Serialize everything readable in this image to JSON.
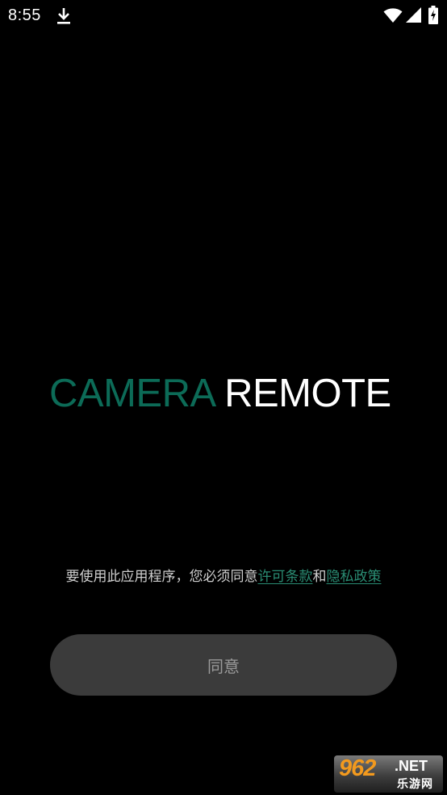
{
  "status_bar": {
    "time": "8:55",
    "icons": [
      "download-icon",
      "wifi-icon",
      "signal-icon",
      "battery-charging-icon"
    ]
  },
  "logo": {
    "part1": "CAMERA",
    "part2": "REMOTE"
  },
  "consent": {
    "prefix": "要使用此应用程序，您必须同意",
    "license_link": "许可条款",
    "conjunction": "和",
    "privacy_link": "隐私政策"
  },
  "agree_button": {
    "label": "同意"
  },
  "watermark": {
    "brand_number": "962",
    "brand_suffix": ".NET",
    "brand_cn": "乐游网"
  },
  "colors": {
    "background": "#000000",
    "brand_green": "#0c6b57",
    "link_green": "#2a8c73",
    "button_bg": "#3b3b3b",
    "button_text": "#9a9a9a"
  }
}
